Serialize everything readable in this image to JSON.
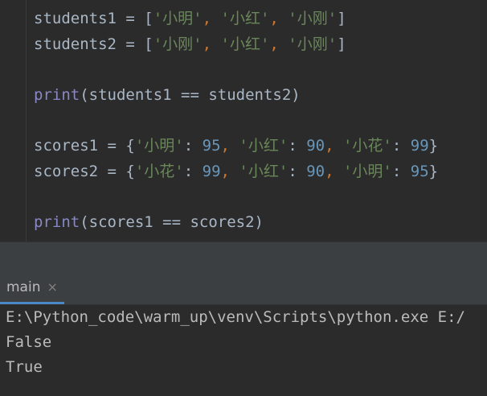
{
  "editor": {
    "line1": {
      "name": "students1",
      "op": " = ",
      "open": "[",
      "s1": "'小明'",
      "c1": ", ",
      "s2": "'小红'",
      "c2": ", ",
      "s3": "'小刚'",
      "close": "]"
    },
    "line2": {
      "name": "students2",
      "op": " = ",
      "open": "[",
      "s1": "'小刚'",
      "c1": ", ",
      "s2": "'小红'",
      "c2": ", ",
      "s3": "'小刚'",
      "close": "]"
    },
    "line3": {
      "func": "print",
      "args": "(students1 == students2)"
    },
    "line4": {
      "name": "scores1",
      "op": " = ",
      "open": "{",
      "k1": "'小明'",
      "col1": ": ",
      "v1": "95",
      "c1": ", ",
      "k2": "'小红'",
      "col2": ": ",
      "v2": "90",
      "c2": ", ",
      "k3": "'小花'",
      "col3": ": ",
      "v3": "99",
      "close": "}"
    },
    "line5": {
      "name": "scores2",
      "op": " = ",
      "open": "{",
      "k1": "'小花'",
      "col1": ": ",
      "v1": "99",
      "c1": ", ",
      "k2": "'小红'",
      "col2": ": ",
      "v2": "90",
      "c2": ", ",
      "k3": "'小明'",
      "col3": ": ",
      "v3": "95",
      "close": "}"
    },
    "line6": {
      "func": "print",
      "args": "(scores1 == scores2)"
    }
  },
  "run_panel": {
    "tab_label": "main",
    "close_glyph": "×"
  },
  "console": {
    "command": "E:\\Python_code\\warm_up\\venv\\Scripts\\python.exe E:/",
    "output1": "False",
    "output2": "True"
  },
  "colors": {
    "background": "#2b2b2b",
    "string": "#6a8759",
    "number": "#6897bb",
    "builtin": "#8888c6",
    "comma": "#cc7832",
    "tab_underline": "#4a88c7"
  }
}
